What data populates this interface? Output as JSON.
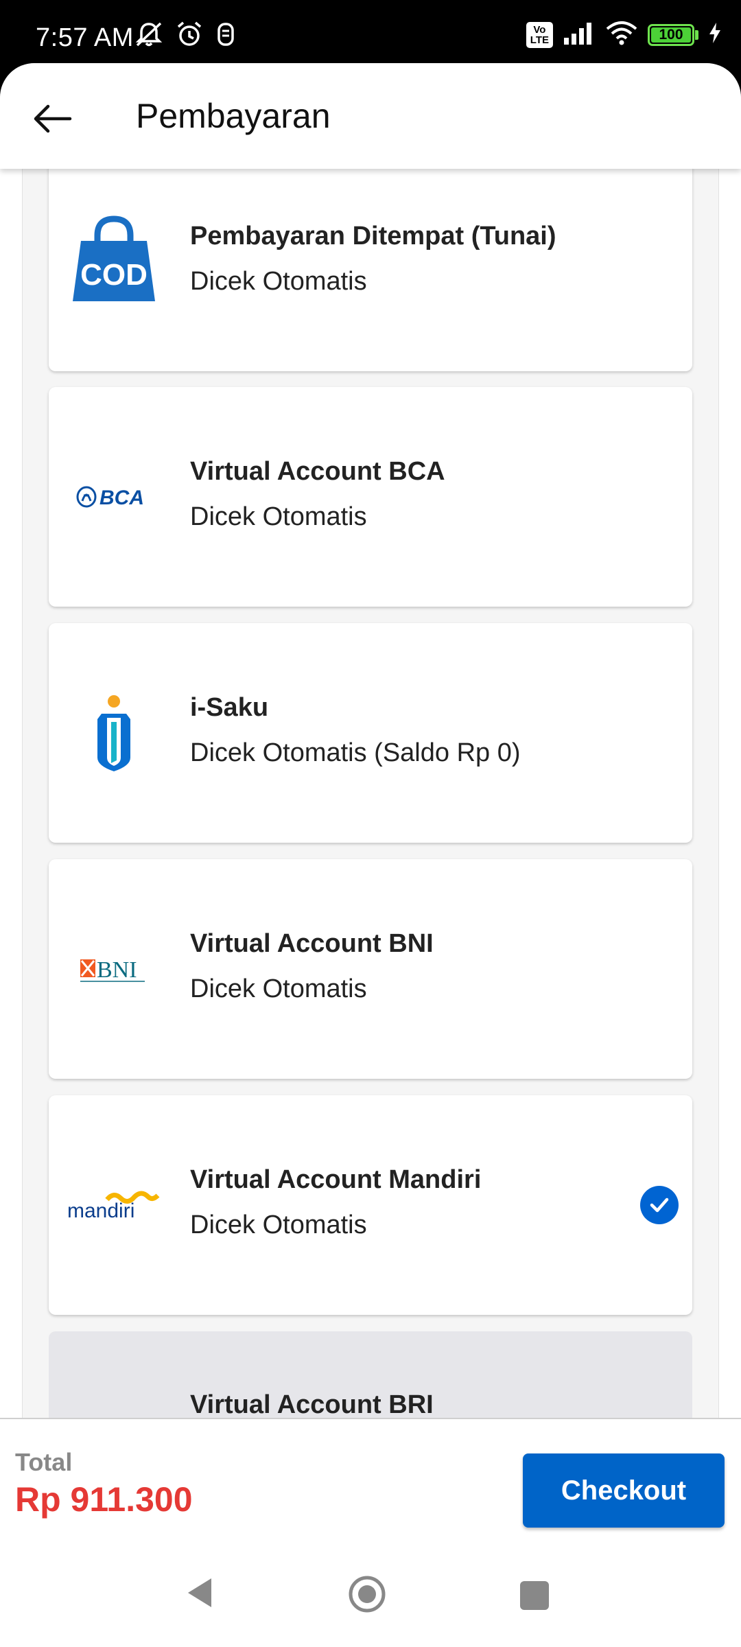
{
  "status_bar": {
    "time": "7:57 AM",
    "battery": "100",
    "volte": "Vo\nLTE",
    "icons": [
      "mute-notifications-icon",
      "alarm-icon",
      "sim-icon",
      "volte-icon",
      "signal-icon",
      "wifi-icon",
      "battery-icon",
      "charging-icon"
    ]
  },
  "header": {
    "title": "Pembayaran",
    "back_icon": "arrow-left-icon"
  },
  "payment_methods": [
    {
      "name": "Pembayaran Ditempat (Tunai)",
      "status": "Dicek Otomatis",
      "logo": "cod-bag-icon",
      "selected": false
    },
    {
      "name": "Virtual Account BCA",
      "status": "Dicek Otomatis",
      "logo": "bca-logo",
      "selected": false
    },
    {
      "name": "i-Saku",
      "status": "Dicek Otomatis (Saldo Rp 0)",
      "logo": "isaku-logo",
      "selected": false
    },
    {
      "name": "Virtual Account BNI",
      "status": "Dicek Otomatis",
      "logo": "bni-logo",
      "selected": false
    },
    {
      "name": "Virtual Account Mandiri",
      "status": "Dicek Otomatis",
      "logo": "mandiri-logo",
      "selected": true
    },
    {
      "name": "Virtual Account BRI",
      "status": "",
      "logo": "",
      "selected": false
    }
  ],
  "logo_text": {
    "cod": "COD",
    "bca": "BCA",
    "bni": "BNI",
    "mandiri": "mandiri"
  },
  "footer": {
    "total_label": "Total",
    "total_value": "Rp 911.300",
    "checkout_label": "Checkout"
  },
  "colors": {
    "primary": "#0064c8",
    "price": "#e53935",
    "cod_blue": "#1a6fc4",
    "bca_blue": "#0a4fa3",
    "bni_orange": "#f15a22",
    "mandiri_blue": "#0b3d8c",
    "mandiri_gold": "#f7b500"
  }
}
